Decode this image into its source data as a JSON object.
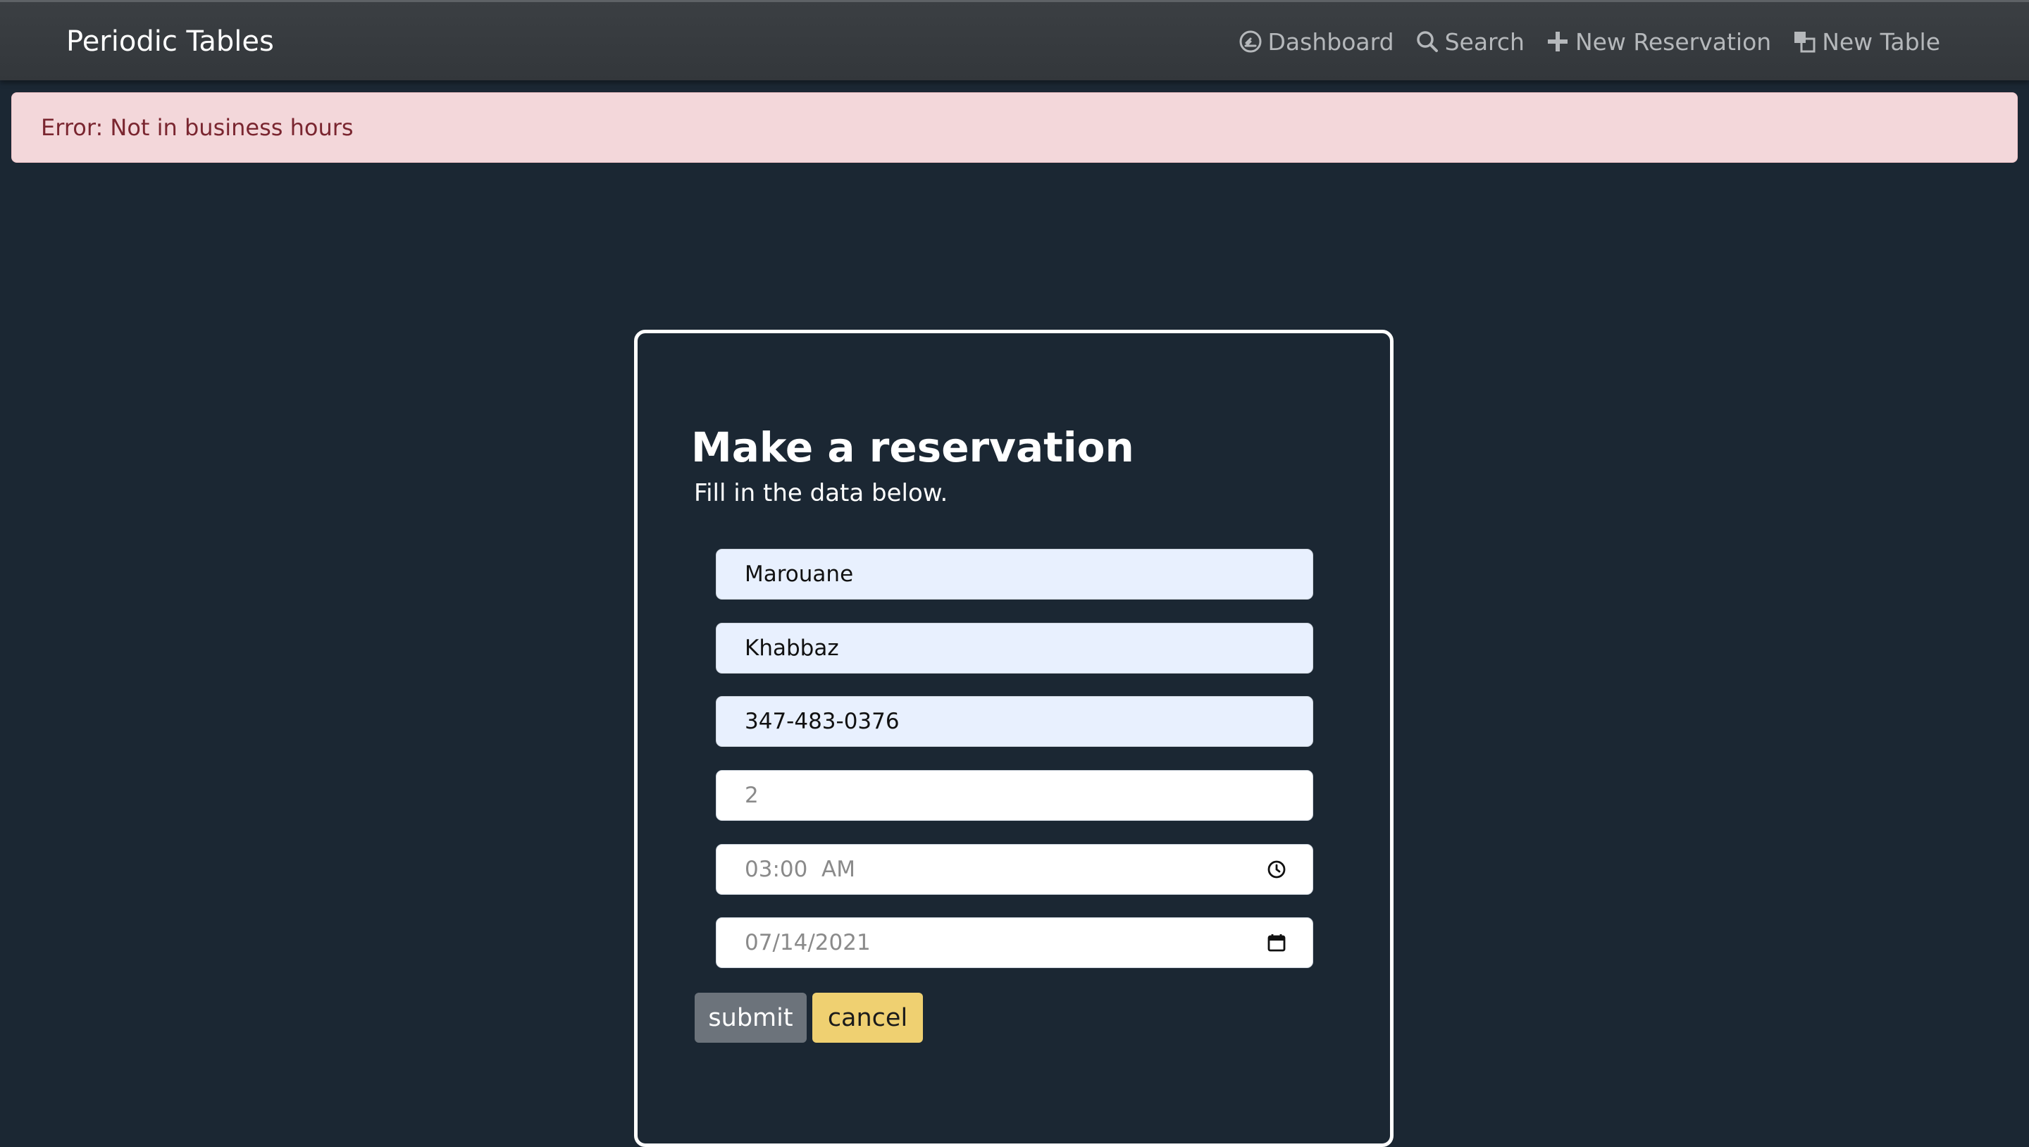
{
  "navbar": {
    "brand": "Periodic Tables",
    "links": [
      {
        "label": "Dashboard",
        "icon": "dashboard-icon"
      },
      {
        "label": "Search",
        "icon": "search-icon"
      },
      {
        "label": "New Reservation",
        "icon": "plus-icon"
      },
      {
        "label": "New Table",
        "icon": "layers-icon"
      }
    ]
  },
  "alert": {
    "message": "Error: Not in business hours"
  },
  "form": {
    "title": "Make a reservation",
    "subtitle": "Fill in the data below.",
    "first_name": "Marouane",
    "last_name": "Khabbaz",
    "mobile_number": "347-483-0376",
    "people": "2",
    "reservation_time": "03:00  AM",
    "reservation_date": "07/14/2021",
    "submit_label": "submit",
    "cancel_label": "cancel"
  },
  "colors": {
    "background": "#1b2733",
    "navbar": "#383c40",
    "alert_bg": "#f3d7da",
    "alert_text": "#7a2630",
    "autofill_bg": "#e8f0fe",
    "submit_bg": "#6c737b",
    "cancel_bg": "#efd071"
  }
}
